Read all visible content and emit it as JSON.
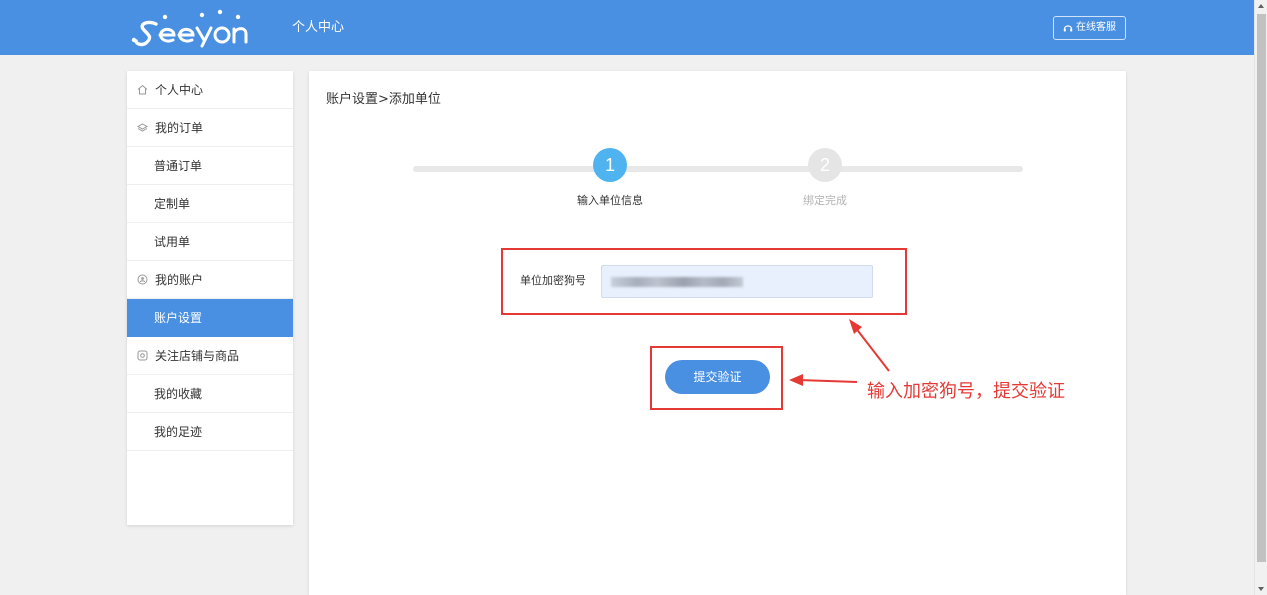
{
  "header": {
    "logo_text": "Seeyon",
    "title": "个人中心",
    "service_label": "在线客服",
    "service_icon": "headset-icon",
    "brand_color": "#4a90e2"
  },
  "sidebar": {
    "items": [
      {
        "label": "个人中心",
        "type": "group",
        "icon": "home-icon",
        "active": false
      },
      {
        "label": "我的订单",
        "type": "group",
        "icon": "layers-icon",
        "active": false
      },
      {
        "label": "普通订单",
        "type": "sub",
        "active": false
      },
      {
        "label": "定制单",
        "type": "sub",
        "active": false
      },
      {
        "label": "试用单",
        "type": "sub",
        "active": false
      },
      {
        "label": "我的账户",
        "type": "group",
        "icon": "account-icon",
        "active": false
      },
      {
        "label": "账户设置",
        "type": "sub",
        "active": true
      },
      {
        "label": "关注店铺与商品",
        "type": "group",
        "icon": "store-icon",
        "active": false
      },
      {
        "label": "我的收藏",
        "type": "sub",
        "active": false
      },
      {
        "label": "我的足迹",
        "type": "sub",
        "active": false
      }
    ]
  },
  "main": {
    "breadcrumb": "账户设置>添加单位",
    "steps": [
      {
        "number": "1",
        "label": "输入单位信息",
        "state": "active"
      },
      {
        "number": "2",
        "label": "绑定完成",
        "state": "pending"
      }
    ],
    "form": {
      "label": "单位加密狗号",
      "value": ""
    },
    "submit_label": "提交验证"
  },
  "annotation": {
    "text": "输入加密狗号，提交验证",
    "color": "#e53935"
  }
}
